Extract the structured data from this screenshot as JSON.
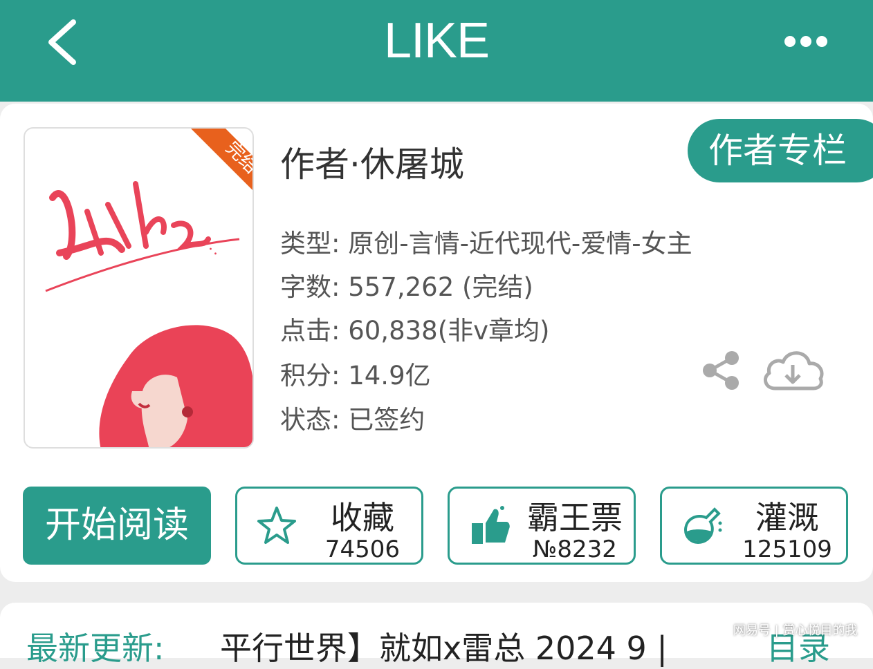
{
  "header": {
    "title": "LIKE",
    "back_icon": "chevron-left-icon",
    "more_icon": "more-dots-icon",
    "bg_color": "#2a9c8c"
  },
  "cover": {
    "badge": "完结",
    "art_text": "LIKE",
    "badge_color": "#e8611d",
    "art_color": "#e94459"
  },
  "book": {
    "author": "作者·休屠城",
    "author_column_button": "作者专栏",
    "meta": [
      "类型: 原创-言情-近代现代-爱情-女主",
      "字数: 557,262 (完结)",
      "点击: 60,838(非v章均)",
      "积分: 14.9亿",
      "状态: 已签约"
    ]
  },
  "actions": {
    "read_button": "开始阅读",
    "stats": [
      {
        "label": "收藏",
        "value": "74506",
        "icon": "star-icon"
      },
      {
        "label": "霸王票",
        "value": "№8232",
        "icon": "thumbs-up-icon"
      },
      {
        "label": "灌溉",
        "value": "125109",
        "icon": "watering-flask-icon"
      }
    ]
  },
  "update": {
    "label": "最新更新:",
    "text": "平行世界】就如x雷总 2024 9 |",
    "more": "目录"
  },
  "watermark": "网易号 | 赏心悦目的我"
}
